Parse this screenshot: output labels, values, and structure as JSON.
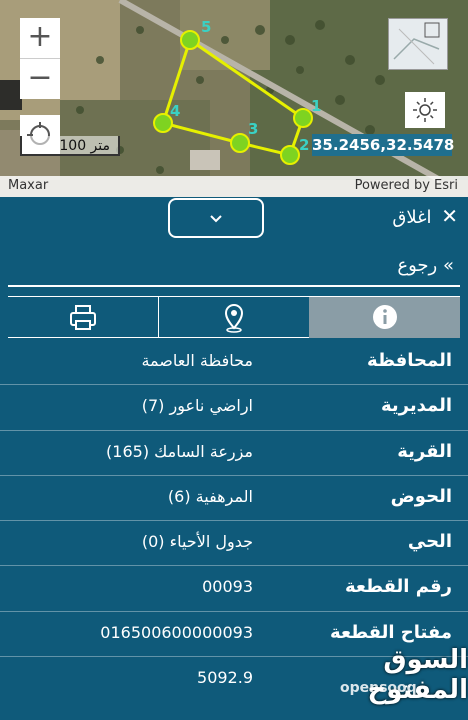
{
  "map": {
    "zoom_in_label": "+",
    "zoom_out_label": "−",
    "scale_label": "100 متر",
    "coordinates": "35.2456,32.5478",
    "attribution_left": "Maxar",
    "attribution_right": "Powered by Esri",
    "vertex_labels": [
      "5",
      "4",
      "3",
      "2",
      "1"
    ],
    "polygon_color": "#e6f000",
    "vertex_color": "#7ed321"
  },
  "panel": {
    "close_label": "اغلاق",
    "back_label": "رجوع",
    "tabs": [
      {
        "name": "print",
        "icon": "printer-icon"
      },
      {
        "name": "location",
        "icon": "location-pin-icon"
      },
      {
        "name": "info",
        "icon": "info-icon",
        "active": true
      }
    ],
    "rows": [
      {
        "key": "المحافظة",
        "value": "محافظة العاصمة"
      },
      {
        "key": "المديرية",
        "value": "اراضي ناعور (7)"
      },
      {
        "key": "القرية",
        "value": "مزرعة السامك (165)"
      },
      {
        "key": "الحوض",
        "value": "المرهفية (6)"
      },
      {
        "key": "الحي",
        "value": "جدول الأحياء (0)"
      },
      {
        "key": "رقم القطعة",
        "value": "00093"
      },
      {
        "key": "مفتاح القطعة",
        "value": "016500600000093"
      },
      {
        "key": "",
        "value": "5092.9"
      }
    ]
  },
  "watermark": {
    "brand": "السوق المفتوح",
    "sub": "opensooq"
  }
}
